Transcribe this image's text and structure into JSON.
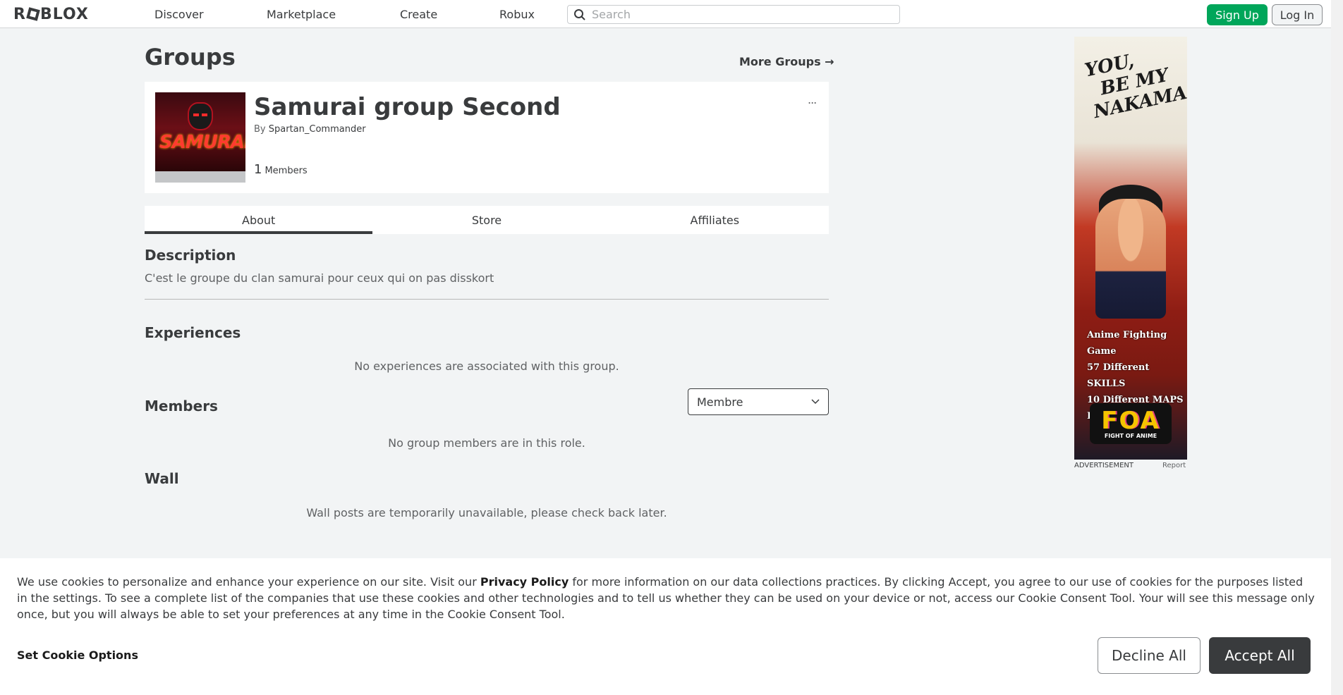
{
  "header": {
    "logo": "ROBLOX",
    "nav": [
      "Discover",
      "Marketplace",
      "Create",
      "Robux"
    ],
    "search_placeholder": "Search",
    "signup_label": "Sign Up",
    "login_label": "Log In"
  },
  "page": {
    "title": "Groups",
    "more_groups": "More Groups →"
  },
  "group": {
    "name": "Samurai group Second",
    "by_prefix": "By",
    "owner": "Spartan_Commander",
    "member_count": "1",
    "member_label": "Members",
    "emblem_text": "SAMURAI",
    "menu_icon": "..."
  },
  "tabs": [
    "About",
    "Store",
    "Affiliates"
  ],
  "about": {
    "description_heading": "Description",
    "description": "C'est le groupe du clan samurai pour ceux qui on pas disskort",
    "experiences_heading": "Experiences",
    "experiences_empty": "No experiences are associated with this group.",
    "members_heading": "Members",
    "role_selected": "Membre",
    "members_empty": "No group members are in this role.",
    "wall_heading": "Wall",
    "wall_message": "Wall posts are temporarily unavailable, please check back later."
  },
  "ad": {
    "headline": [
      "YOU,",
      "BE MY",
      "NAKAMA!"
    ],
    "features": [
      "Anime Fighting Game",
      "57 Different SKILLS",
      "10 Different MAPS",
      "EASY Operation"
    ],
    "brand": "FOA",
    "brand_sub": "FIGHT OF ANIME",
    "label": "ADVERTISEMENT",
    "report": "Report"
  },
  "cookie": {
    "text_before": "We use cookies to personalize and enhance your experience on our site. Visit our ",
    "privacy_link": "Privacy Policy",
    "text_after": " for more information on our data collections practices. By clicking Accept, you agree to our use of cookies for the purposes listed in the settings. To see a complete list of the companies that use these cookies and other technologies and to tell us whether they can be used on your device or not, access our Cookie Consent Tool. Your will see this message only once, but you will always be able to set your preferences at any time in the Cookie Consent Tool.",
    "set_options": "Set Cookie Options",
    "decline": "Decline All",
    "accept": "Accept All"
  }
}
